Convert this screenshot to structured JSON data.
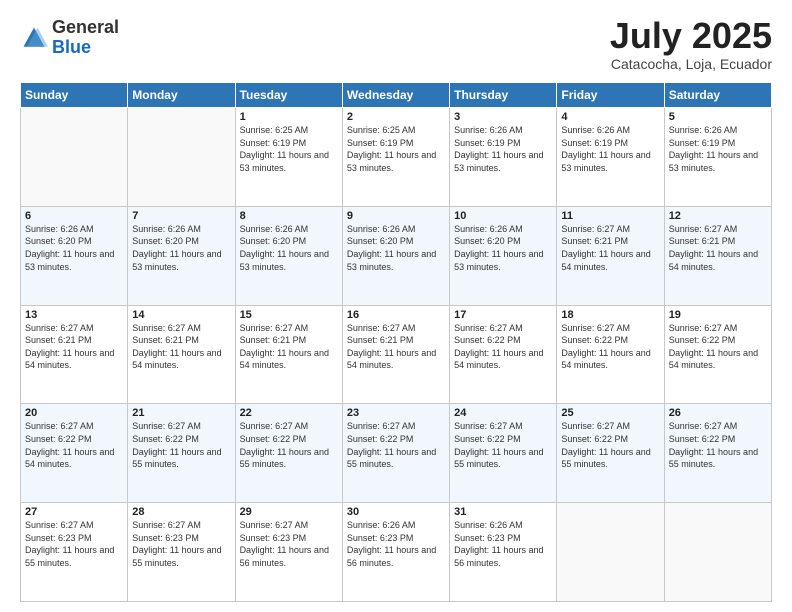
{
  "header": {
    "logo_general": "General",
    "logo_blue": "Blue",
    "month_title": "July 2025",
    "location": "Catacocha, Loja, Ecuador"
  },
  "weekdays": [
    "Sunday",
    "Monday",
    "Tuesday",
    "Wednesday",
    "Thursday",
    "Friday",
    "Saturday"
  ],
  "weeks": [
    [
      {
        "day": "",
        "info": ""
      },
      {
        "day": "",
        "info": ""
      },
      {
        "day": "1",
        "info": "Sunrise: 6:25 AM\nSunset: 6:19 PM\nDaylight: 11 hours and 53 minutes."
      },
      {
        "day": "2",
        "info": "Sunrise: 6:25 AM\nSunset: 6:19 PM\nDaylight: 11 hours and 53 minutes."
      },
      {
        "day": "3",
        "info": "Sunrise: 6:26 AM\nSunset: 6:19 PM\nDaylight: 11 hours and 53 minutes."
      },
      {
        "day": "4",
        "info": "Sunrise: 6:26 AM\nSunset: 6:19 PM\nDaylight: 11 hours and 53 minutes."
      },
      {
        "day": "5",
        "info": "Sunrise: 6:26 AM\nSunset: 6:19 PM\nDaylight: 11 hours and 53 minutes."
      }
    ],
    [
      {
        "day": "6",
        "info": "Sunrise: 6:26 AM\nSunset: 6:20 PM\nDaylight: 11 hours and 53 minutes."
      },
      {
        "day": "7",
        "info": "Sunrise: 6:26 AM\nSunset: 6:20 PM\nDaylight: 11 hours and 53 minutes."
      },
      {
        "day": "8",
        "info": "Sunrise: 6:26 AM\nSunset: 6:20 PM\nDaylight: 11 hours and 53 minutes."
      },
      {
        "day": "9",
        "info": "Sunrise: 6:26 AM\nSunset: 6:20 PM\nDaylight: 11 hours and 53 minutes."
      },
      {
        "day": "10",
        "info": "Sunrise: 6:26 AM\nSunset: 6:20 PM\nDaylight: 11 hours and 53 minutes."
      },
      {
        "day": "11",
        "info": "Sunrise: 6:27 AM\nSunset: 6:21 PM\nDaylight: 11 hours and 54 minutes."
      },
      {
        "day": "12",
        "info": "Sunrise: 6:27 AM\nSunset: 6:21 PM\nDaylight: 11 hours and 54 minutes."
      }
    ],
    [
      {
        "day": "13",
        "info": "Sunrise: 6:27 AM\nSunset: 6:21 PM\nDaylight: 11 hours and 54 minutes."
      },
      {
        "day": "14",
        "info": "Sunrise: 6:27 AM\nSunset: 6:21 PM\nDaylight: 11 hours and 54 minutes."
      },
      {
        "day": "15",
        "info": "Sunrise: 6:27 AM\nSunset: 6:21 PM\nDaylight: 11 hours and 54 minutes."
      },
      {
        "day": "16",
        "info": "Sunrise: 6:27 AM\nSunset: 6:21 PM\nDaylight: 11 hours and 54 minutes."
      },
      {
        "day": "17",
        "info": "Sunrise: 6:27 AM\nSunset: 6:22 PM\nDaylight: 11 hours and 54 minutes."
      },
      {
        "day": "18",
        "info": "Sunrise: 6:27 AM\nSunset: 6:22 PM\nDaylight: 11 hours and 54 minutes."
      },
      {
        "day": "19",
        "info": "Sunrise: 6:27 AM\nSunset: 6:22 PM\nDaylight: 11 hours and 54 minutes."
      }
    ],
    [
      {
        "day": "20",
        "info": "Sunrise: 6:27 AM\nSunset: 6:22 PM\nDaylight: 11 hours and 54 minutes."
      },
      {
        "day": "21",
        "info": "Sunrise: 6:27 AM\nSunset: 6:22 PM\nDaylight: 11 hours and 55 minutes."
      },
      {
        "day": "22",
        "info": "Sunrise: 6:27 AM\nSunset: 6:22 PM\nDaylight: 11 hours and 55 minutes."
      },
      {
        "day": "23",
        "info": "Sunrise: 6:27 AM\nSunset: 6:22 PM\nDaylight: 11 hours and 55 minutes."
      },
      {
        "day": "24",
        "info": "Sunrise: 6:27 AM\nSunset: 6:22 PM\nDaylight: 11 hours and 55 minutes."
      },
      {
        "day": "25",
        "info": "Sunrise: 6:27 AM\nSunset: 6:22 PM\nDaylight: 11 hours and 55 minutes."
      },
      {
        "day": "26",
        "info": "Sunrise: 6:27 AM\nSunset: 6:22 PM\nDaylight: 11 hours and 55 minutes."
      }
    ],
    [
      {
        "day": "27",
        "info": "Sunrise: 6:27 AM\nSunset: 6:23 PM\nDaylight: 11 hours and 55 minutes."
      },
      {
        "day": "28",
        "info": "Sunrise: 6:27 AM\nSunset: 6:23 PM\nDaylight: 11 hours and 55 minutes."
      },
      {
        "day": "29",
        "info": "Sunrise: 6:27 AM\nSunset: 6:23 PM\nDaylight: 11 hours and 56 minutes."
      },
      {
        "day": "30",
        "info": "Sunrise: 6:26 AM\nSunset: 6:23 PM\nDaylight: 11 hours and 56 minutes."
      },
      {
        "day": "31",
        "info": "Sunrise: 6:26 AM\nSunset: 6:23 PM\nDaylight: 11 hours and 56 minutes."
      },
      {
        "day": "",
        "info": ""
      },
      {
        "day": "",
        "info": ""
      }
    ]
  ]
}
